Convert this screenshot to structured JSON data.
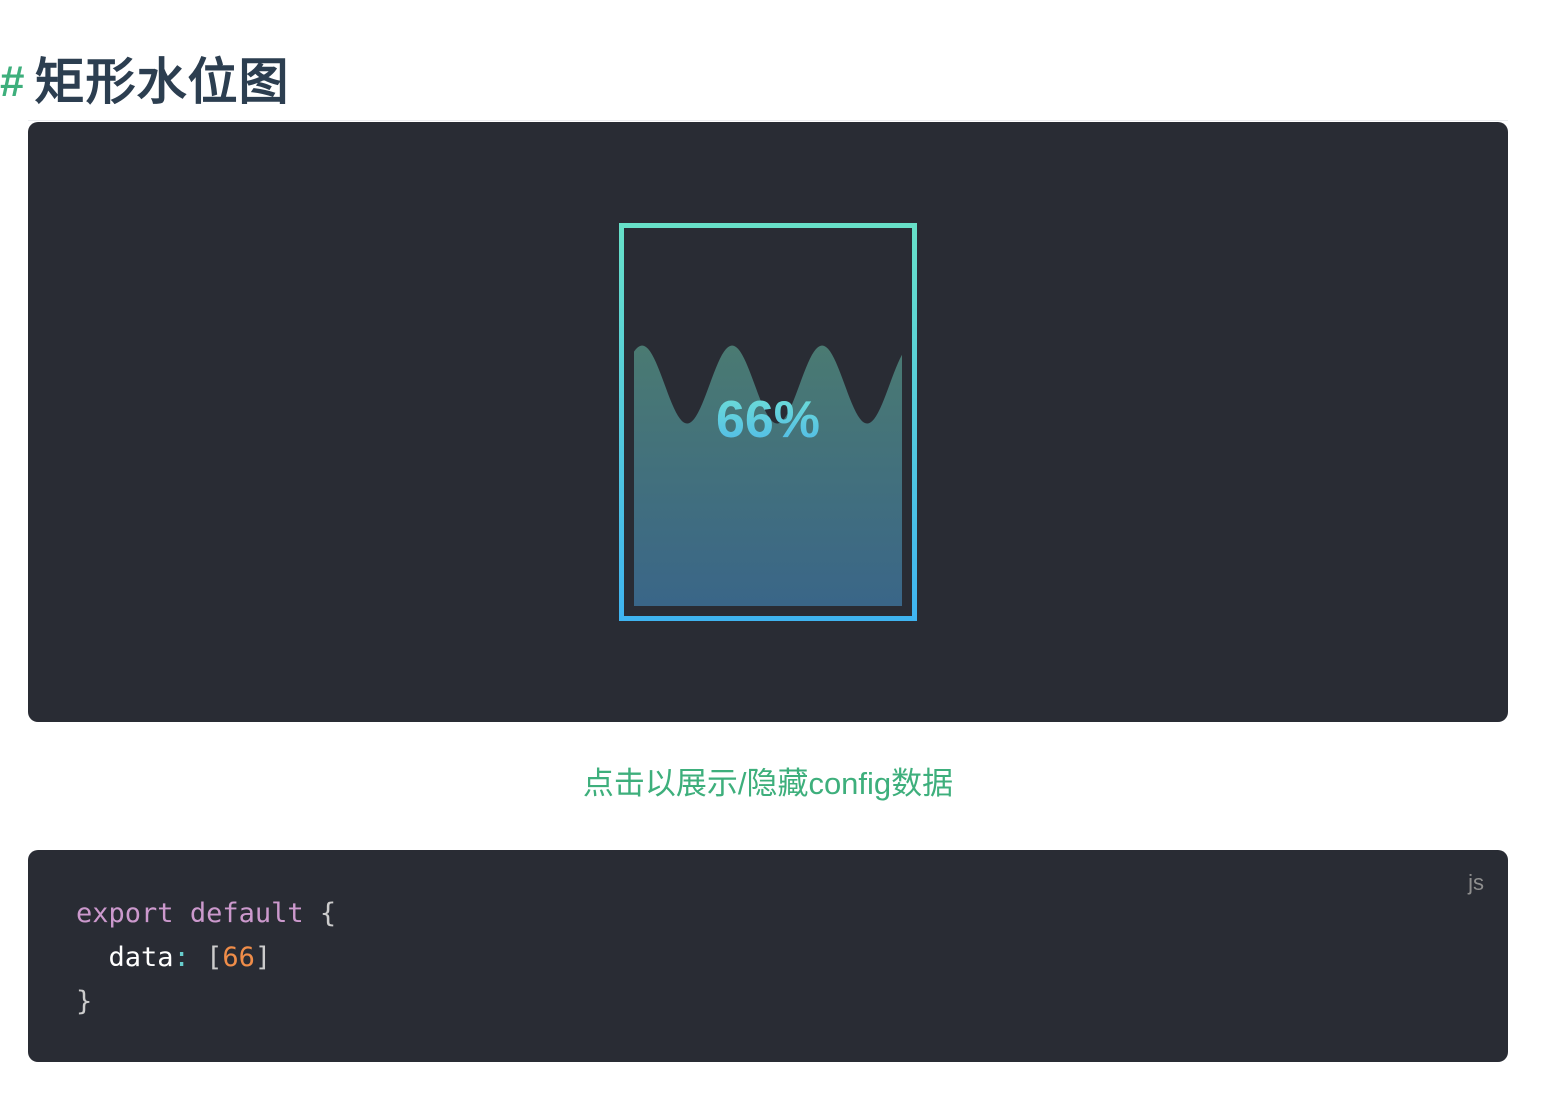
{
  "heading": {
    "anchor": "#",
    "title": "矩形水位图"
  },
  "chart_data": {
    "type": "water-level",
    "shape": "rect",
    "values": [
      66
    ],
    "label": "66%",
    "colors": {
      "border_top": "#67e0c8",
      "border_bottom": "#3fb4f0",
      "fill_top": "#4a7a72",
      "fill_bottom": "#3a6688",
      "label_top": "#6fe0d6",
      "label_bottom": "#4fb8e8",
      "background": "#292c34"
    }
  },
  "toggle": {
    "label": "点击以展示/隐藏config数据"
  },
  "code": {
    "lang": "js",
    "line1_kw1": "export",
    "line1_kw2": "default",
    "line1_brace": "{",
    "line2_prop": "data",
    "line2_colon": ":",
    "line2_open": "[",
    "line2_value": "66",
    "line2_close": "]",
    "line3_brace": "}"
  }
}
